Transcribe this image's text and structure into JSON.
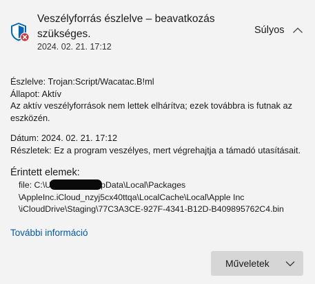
{
  "header": {
    "title": "Veszélyforrás észlelve – beavatkozás szükséges.",
    "date": "2024. 02. 21. 17:12",
    "severity": "Súlyos",
    "icon": "shield-warning-icon",
    "accent_color": "#0067c0",
    "alert_color": "#d13438"
  },
  "details": {
    "detected_label": "Észlelve:",
    "detected_value": "Trojan:Script/Wacatac.B!ml",
    "status_label": "Állapot:",
    "status_value": "Aktív",
    "status_message": "Az aktív veszélyforrások nem lettek elhárítva; ezek továbbra is futnak az eszközén.",
    "date_label": "Dátum:",
    "date_value": "2024. 02. 21. 17:12",
    "details_label": "Részletek:",
    "details_value": "Ez a program veszélyes, mert végrehajtja a támadó utasításait."
  },
  "affected": {
    "heading": "Érintett elemek:",
    "file_prefix": "file: C:\\U",
    "file_after_redaction": "pData\\Local\\Packages",
    "file_line2": "\\AppleInc.iCloud_nzyj5cx40ttqa\\LocalCache\\Local\\Apple Inc",
    "file_line3": "\\iCloudDrive\\Staging\\77C3A3CE-927F-4341-B12D-B409895762C4.bin"
  },
  "more_info_link": "További információ",
  "actions_button": "Műveletek"
}
